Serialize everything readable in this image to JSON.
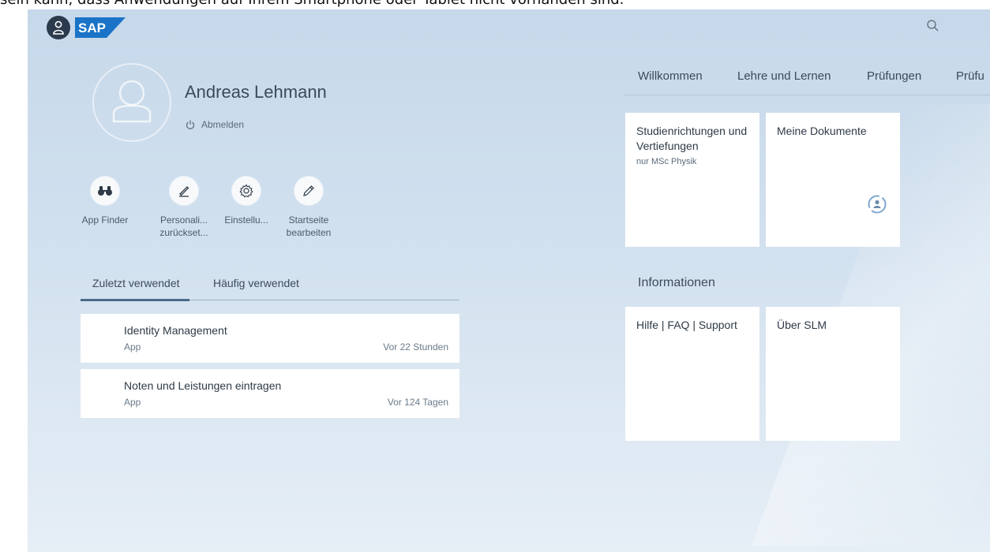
{
  "caption": "sein kann, dass Anwendungen auf Ihrem Smartphone oder Tablet nicht vorhanden sind.",
  "shell": {
    "avatar_icon": "user-icon",
    "logo_text": "SAP",
    "search_icon": "search-icon"
  },
  "profile": {
    "name": "Andreas Lehmann",
    "logout_label": "Abmelden",
    "actions": [
      {
        "label": "App Finder",
        "icon": "binoculars-icon"
      },
      {
        "label": "Personali... zurückset...",
        "icon": "pen-icon"
      },
      {
        "label": "Einstellu...",
        "icon": "gear-icon"
      },
      {
        "label": "Startseite bearbeiten",
        "icon": "pencil-icon"
      }
    ]
  },
  "recent": {
    "tabs": [
      "Zuletzt verwendet",
      "Häufig verwendet"
    ],
    "items": [
      {
        "title": "Identity Management",
        "type": "App",
        "time": "Vor 22 Stunden"
      },
      {
        "title": "Noten und Leistungen eintragen",
        "type": "App",
        "time": "Vor 124 Tagen"
      }
    ]
  },
  "nav": {
    "anchors": [
      "Willkommen",
      "Lehre und Lernen",
      "Prüfungen",
      "Prüfu"
    ]
  },
  "groups": [
    {
      "title": "",
      "tiles": [
        {
          "title": "Studienrichtungen und Vertiefungen",
          "subtitle": "nur MSc Physik"
        },
        {
          "title": "Meine Dokumente",
          "subtitle": ""
        }
      ]
    },
    {
      "title": "Informationen",
      "tiles": [
        {
          "title": "Hilfe | FAQ | Support",
          "subtitle": ""
        },
        {
          "title": "Über SLM",
          "subtitle": ""
        }
      ]
    }
  ],
  "colors": {
    "background": "#c6d8ea",
    "shell_avatar": "#2b3a4d",
    "sap_blue": "#1a73c7",
    "tile": "#ffffff"
  }
}
